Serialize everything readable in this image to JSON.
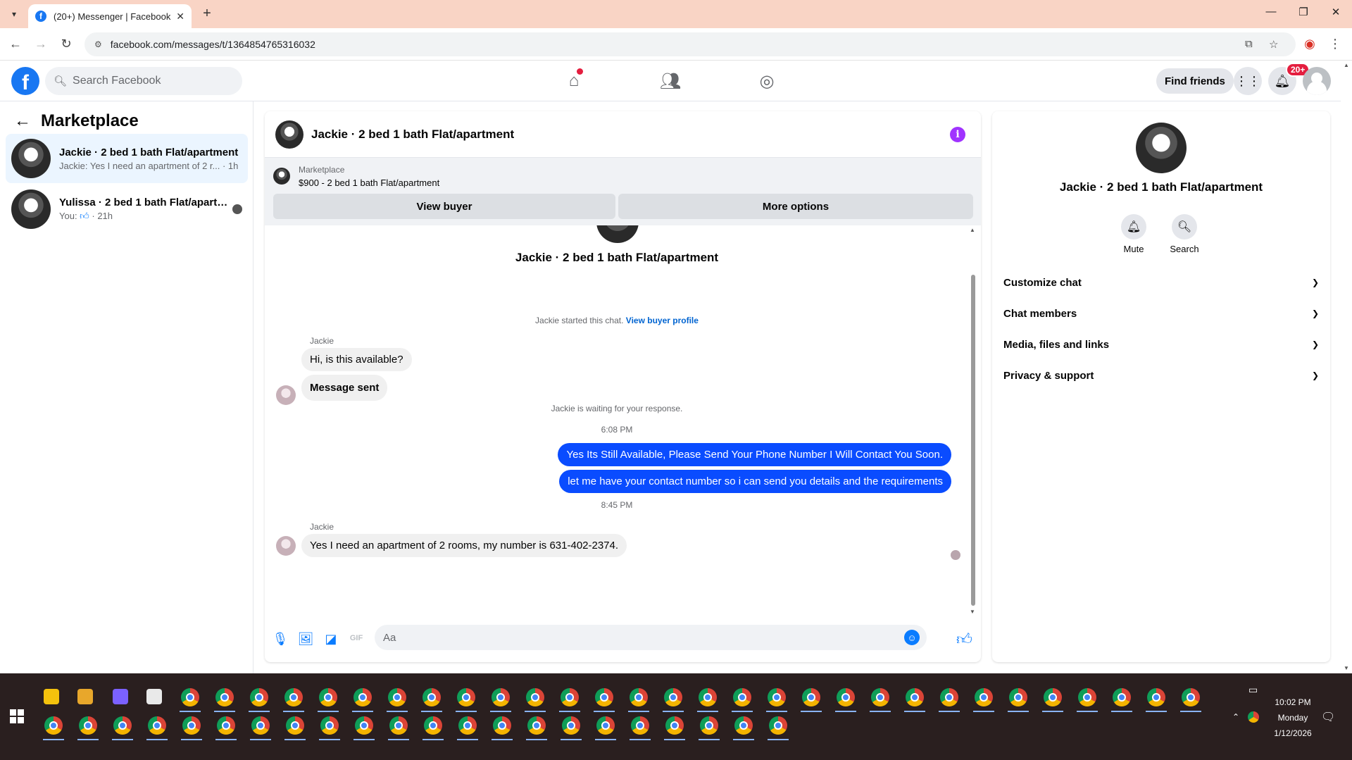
{
  "browser": {
    "tab_title": "(20+) Messenger | Facebook",
    "tab_close": "✕",
    "new_tab": "+",
    "url": "facebook.com/messages/t/1364854765316032",
    "window": {
      "minimize": "—",
      "restore": "❐",
      "close": "✕"
    }
  },
  "fb_header": {
    "logo": "f",
    "search_placeholder": "Search Facebook",
    "find_friends": "Find friends",
    "notification_badge": "20+"
  },
  "sidebar": {
    "title": "Marketplace",
    "conversations": [
      {
        "name": "Jackie · 2 bed 1 bath Flat/apartment",
        "preview": "Jackie: Yes I need an apartment of 2 r... · 1h",
        "active": true
      },
      {
        "name": "Yulissa · 2 bed 1 bath Flat/apartment",
        "preview_prefix": "You: ",
        "preview_suffix": " · 21h",
        "active": false
      }
    ]
  },
  "chat": {
    "header_name": "Jackie · 2 bed 1 bath Flat/apartment",
    "marketplace": {
      "label": "Marketplace",
      "listing": "$900 - 2 bed 1 bath Flat/apartment",
      "view_buyer": "View buyer",
      "more_options": "More options"
    },
    "top_name": "Jackie · 2 bed 1 bath Flat/apartment",
    "started_text": "Jackie started this chat.",
    "view_buyer_profile": "View buyer profile",
    "sender1": "Jackie",
    "msg_in_1": "Hi, is this available?",
    "msg_in_2": "Message sent",
    "waiting": "Jackie is waiting for your response.",
    "time1": "6:08 PM",
    "msg_out_1": "Yes Its Still Available, Please Send Your Phone Number I Will Contact You Soon.",
    "msg_out_2": "let me have your contact number so i can send you details and the requirements",
    "time2": "8:45 PM",
    "sender2": "Jackie",
    "msg_in_3": "Yes I need an apartment of 2 rooms, my number is 631-402-2374.",
    "composer_placeholder": "Aa"
  },
  "right_panel": {
    "name": "Jackie · 2 bed 1 bath Flat/apartment",
    "mute": "Mute",
    "search": "Search",
    "rows": [
      "Customize chat",
      "Chat members",
      "Media, files and links",
      "Privacy & support"
    ]
  },
  "taskbar": {
    "time": "10:02 PM",
    "day": "Monday",
    "date": "1/12/2026"
  },
  "colors": {
    "facebook_blue": "#1877f2",
    "outgoing_bubble": "#0a4cff",
    "tab_bar": "#f9d4c5",
    "taskbar": "#2a1f1f"
  }
}
